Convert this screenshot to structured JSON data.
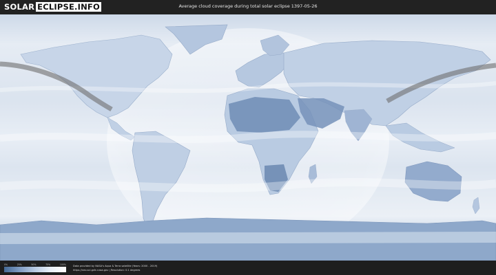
{
  "header": {
    "logo_left": "SOLAR",
    "logo_right": "ECLIPSE.INFO",
    "title": "Average cloud coverage during total solar eclipse 1397-05-26"
  },
  "legend": {
    "ticks": [
      "0%",
      "25%",
      "50%",
      "75%",
      "100%"
    ],
    "gradient_colors": [
      "#456a96",
      "#7f9cc3",
      "#b9cbe3",
      "#e9f0f8",
      "#ffffff"
    ]
  },
  "footer": {
    "credit_line": "Data provided by NASA's Aqua & Terra satellite (Years: 2000 - 2019)",
    "source_line": "https://neo.sci.gsfc.nasa.gov | Resolution: 0.1 degrees"
  },
  "colors": {
    "background": "#1e1e1e",
    "ocean": "#e6edf6",
    "cloud_high": "#ffffff",
    "cloud_low": "#456a96",
    "eclipse_path": "#6e6e6e"
  }
}
